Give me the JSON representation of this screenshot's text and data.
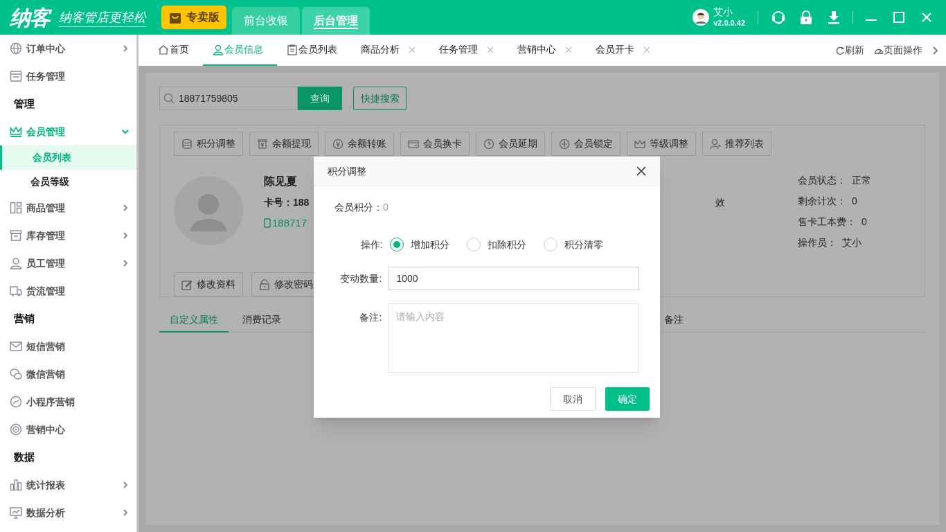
{
  "app_bar": {
    "logo": "纳客",
    "slogan": "纳客管店更轻松",
    "edition": "专卖版",
    "modes": [
      {
        "label": "前台收银",
        "selected": false
      },
      {
        "label": "后台管理",
        "selected": true
      }
    ],
    "user": {
      "name": "艾小",
      "version": "v2.0.0.42"
    }
  },
  "sidebar": {
    "items": [
      {
        "kind": "item",
        "label": "订单中心",
        "expanded": false
      },
      {
        "kind": "item",
        "label": "任务管理"
      },
      {
        "kind": "section",
        "label": "管理"
      },
      {
        "kind": "item",
        "label": "会员管理",
        "expanded": true,
        "children": [
          {
            "label": "会员列表",
            "selected": true
          },
          {
            "label": "会员等级",
            "selected": false
          }
        ]
      },
      {
        "kind": "item",
        "label": "商品管理",
        "expanded": false
      },
      {
        "kind": "item",
        "label": "库存管理",
        "expanded": false
      },
      {
        "kind": "item",
        "label": "员工管理",
        "expanded": false
      },
      {
        "kind": "item",
        "label": "货流管理"
      },
      {
        "kind": "section",
        "label": "营销"
      },
      {
        "kind": "item",
        "label": "短信营销"
      },
      {
        "kind": "item",
        "label": "微信营销"
      },
      {
        "kind": "item",
        "label": "小程序营销"
      },
      {
        "kind": "item",
        "label": "营销中心"
      },
      {
        "kind": "section",
        "label": "数据"
      },
      {
        "kind": "item",
        "label": "统计报表",
        "expanded": false
      },
      {
        "kind": "item",
        "label": "数据分析",
        "expanded": false
      }
    ]
  },
  "page_tabs": {
    "tabs": [
      {
        "label": "首页",
        "selected": false,
        "closable": false
      },
      {
        "label": "会员信息",
        "selected": true,
        "closable": false
      },
      {
        "label": "会员列表",
        "selected": false,
        "closable": false
      },
      {
        "label": "商品分析",
        "selected": false,
        "closable": true
      },
      {
        "label": "任务管理",
        "selected": false,
        "closable": true
      },
      {
        "label": "营销中心",
        "selected": false,
        "closable": true
      },
      {
        "label": "会员开卡",
        "selected": false,
        "closable": true
      }
    ],
    "actions": [
      "刷新",
      "页面操作"
    ]
  },
  "search": {
    "value": "18871759805",
    "button": "查询",
    "quick_button": "快捷搜索"
  },
  "member": {
    "actions": [
      "积分调整",
      "余额提现",
      "余额转账",
      "会员换卡",
      "会员延期",
      "会员锁定",
      "等级调整",
      "推荐列表"
    ],
    "name": "陈见夏",
    "card": "卡号：188",
    "phone": "188717",
    "column_2": "效",
    "details": [
      {
        "label": "会员状态：",
        "value": "正常"
      },
      {
        "label": "剩余计次：",
        "value": "0"
      },
      {
        "label": "售卡工本费：",
        "value": "0"
      },
      {
        "label": "操作员：",
        "value": "艾小"
      }
    ],
    "edit_buttons": [
      "修改资料",
      "修改密码"
    ],
    "tabs": [
      {
        "label": "自定义属性",
        "selected": true
      },
      {
        "label": "消费记录",
        "selected": false
      },
      {
        "label": "备注",
        "selected": false
      }
    ]
  },
  "dialog": {
    "title": "积分调整",
    "points_label": "会员积分：",
    "points_value": "0",
    "operation_label": "操作:",
    "options": [
      {
        "label": "增加积分",
        "selected": true
      },
      {
        "label": "扣除积分",
        "selected": false
      },
      {
        "label": "积分清零",
        "selected": false
      }
    ],
    "amount_label": "变动数量:",
    "amount_value": "1000",
    "note_label": "备注:",
    "note_placeholder": "请输入内容",
    "buttons": [
      "取消",
      "确定"
    ]
  }
}
